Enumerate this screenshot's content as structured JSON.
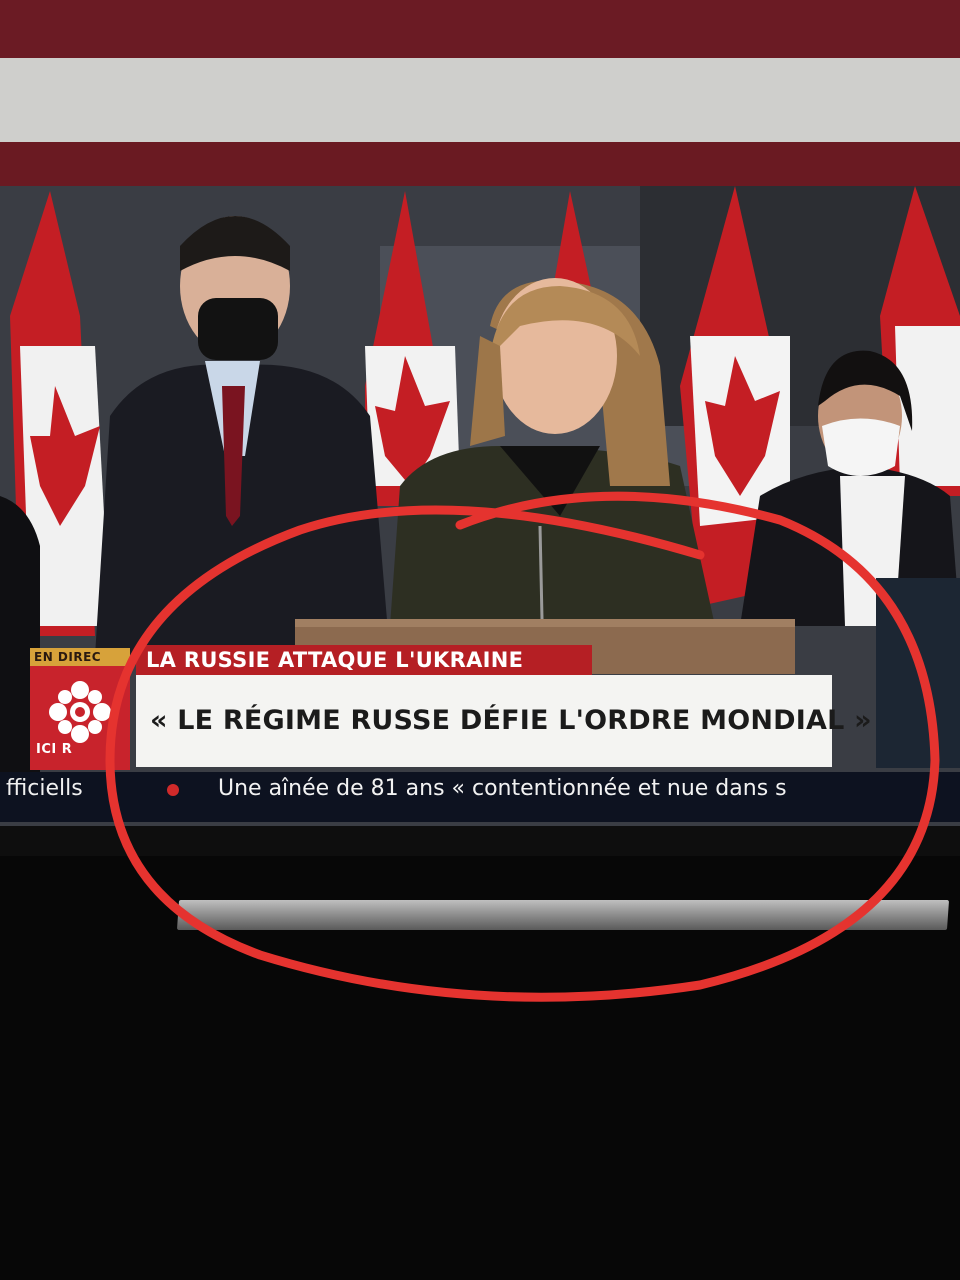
{
  "broadcast": {
    "live_label": "EN DIREC",
    "channel_logo_text": "ICI R",
    "category": "LA RUSSIE ATTAQUE L'UKRAINE",
    "headline": "« LE RÉGIME RUSSE DÉFIE L'ORDRE MONDIAL »",
    "ticker_left": "fficiell",
    "ticker_left_suffix": "s",
    "ticker_main": "Une aînée de 81 ans « contentionnée et nue dans s"
  },
  "colors": {
    "cbc_red": "#c8232c",
    "category_red": "#b51f24",
    "annotation_red": "#e5332f",
    "live_gold": "#d7a23a",
    "ticker_navy": "#0d1220"
  }
}
